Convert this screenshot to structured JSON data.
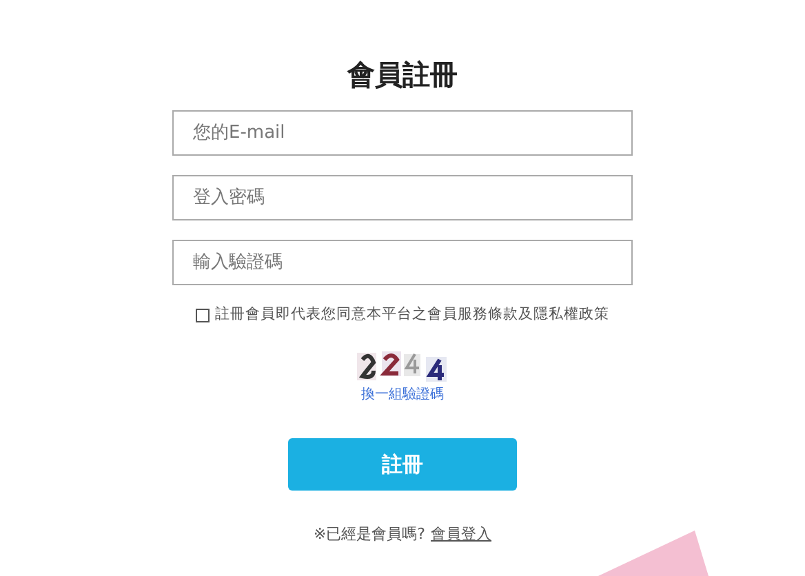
{
  "title": "會員註冊",
  "fields": [
    {
      "placeholder": "您的E-mail"
    },
    {
      "placeholder": "登入密碼"
    },
    {
      "placeholder": "輸入驗證碼"
    }
  ],
  "agreement": {
    "checked": false,
    "label": "註冊會員即代表您同意本平台之會員服務條款及隱私權政策"
  },
  "captcha": {
    "kind": "picture",
    "refresh_link": "換一組驗證碼"
  },
  "submit_button": "註冊",
  "footer": {
    "text": "※已經是會員嗎?",
    "link": "會員登入"
  }
}
